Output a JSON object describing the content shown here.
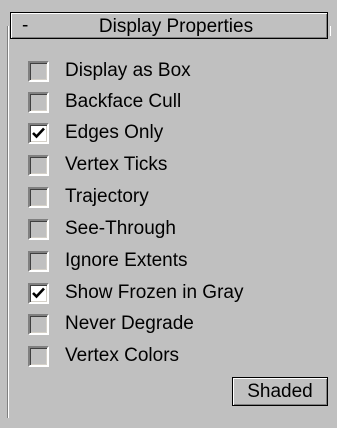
{
  "rollout": {
    "collapse_symbol": "-",
    "title": "Display Properties"
  },
  "options": [
    {
      "label": "Display as Box",
      "checked": false
    },
    {
      "label": "Backface Cull",
      "checked": false
    },
    {
      "label": "Edges Only",
      "checked": true
    },
    {
      "label": "Vertex Ticks",
      "checked": false
    },
    {
      "label": "Trajectory",
      "checked": false
    },
    {
      "label": "See-Through",
      "checked": false
    },
    {
      "label": "Ignore Extents",
      "checked": false
    },
    {
      "label": "Show Frozen in Gray",
      "checked": true
    },
    {
      "label": "Never Degrade",
      "checked": false
    },
    {
      "label": "Vertex Colors",
      "checked": false
    }
  ],
  "shaded_button": {
    "label": "Shaded"
  },
  "icons": {
    "check": "checkmark-icon"
  }
}
